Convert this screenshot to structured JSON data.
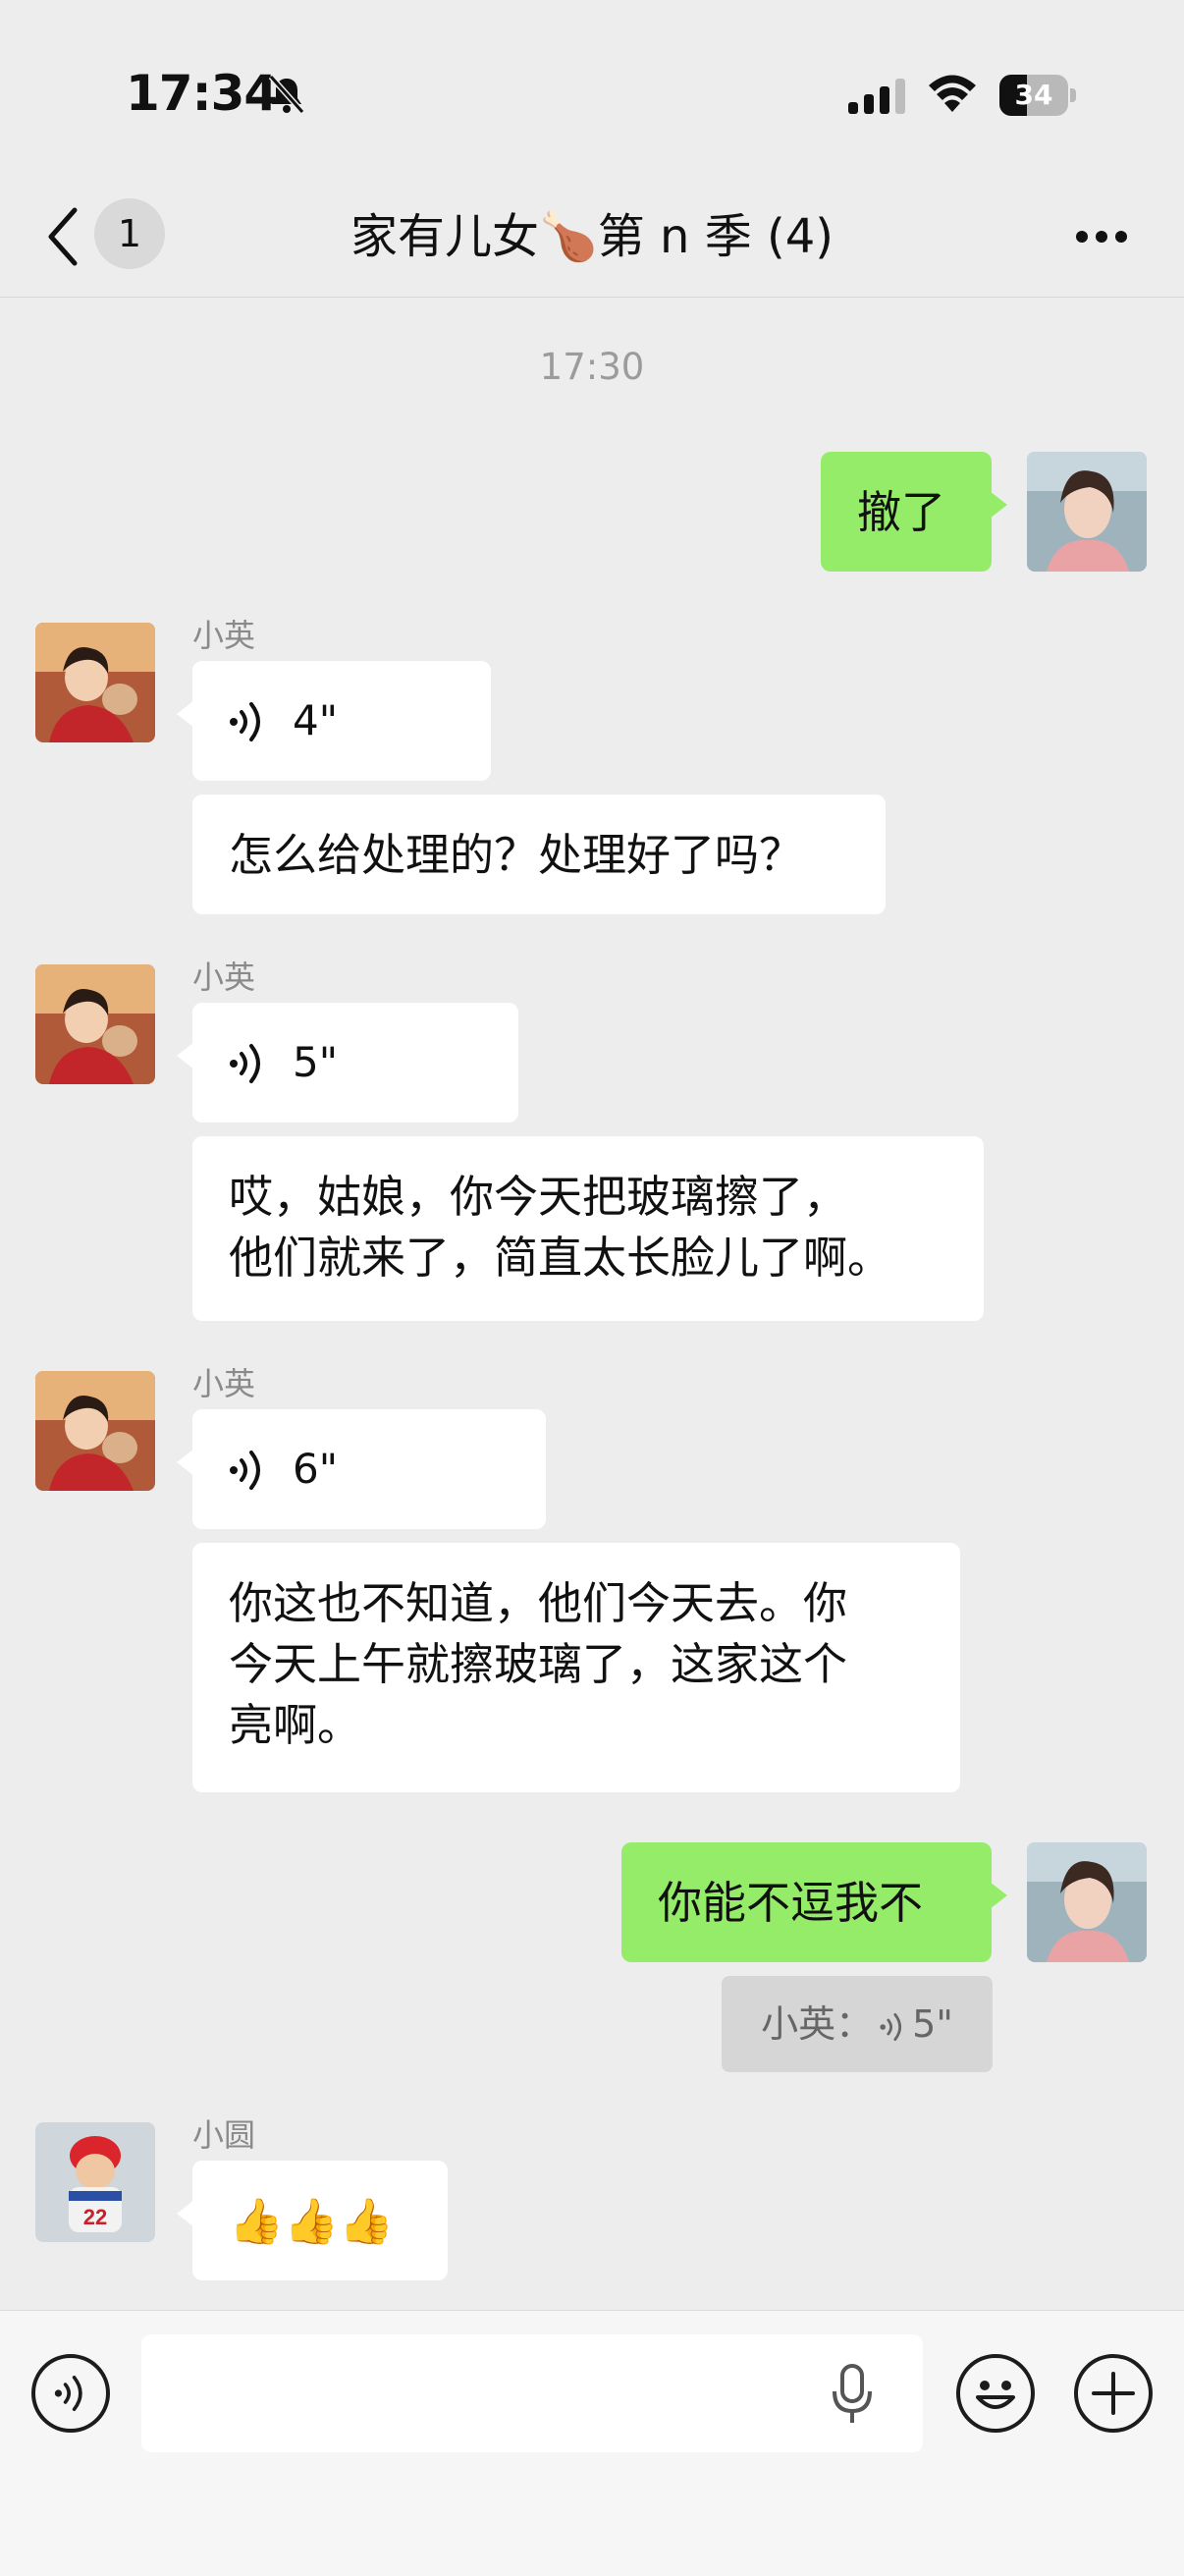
{
  "status_bar": {
    "time": "17:34",
    "battery": "34"
  },
  "nav": {
    "back_count": "1",
    "title": "家有儿女🍗第 n 季 (4)"
  },
  "timestamp": "17:30",
  "messages": {
    "m1": {
      "text": "撤了"
    },
    "m2": {
      "sender": "小英",
      "voice_duration": "4\"",
      "text": "怎么给处理的？处理好了吗？"
    },
    "m3": {
      "sender": "小英",
      "voice_duration": "5\"",
      "text_line1": "哎，姑娘，你今天把玻璃擦了，",
      "text_line2": "他们就来了，简直太长脸儿了啊。"
    },
    "m4": {
      "sender": "小英",
      "voice_duration": "6\"",
      "text_line1": "你这也不知道，他们今天去。你",
      "text_line2": "今天上午就擦玻璃了，这家这个",
      "text_line3": "亮啊。"
    },
    "m5": {
      "text": "你能不逗我不",
      "quote_name": "小英：",
      "quote_duration": "5\""
    },
    "m6": {
      "sender": "小圆",
      "text": "👍👍👍"
    }
  },
  "input": {
    "placeholder": ""
  }
}
